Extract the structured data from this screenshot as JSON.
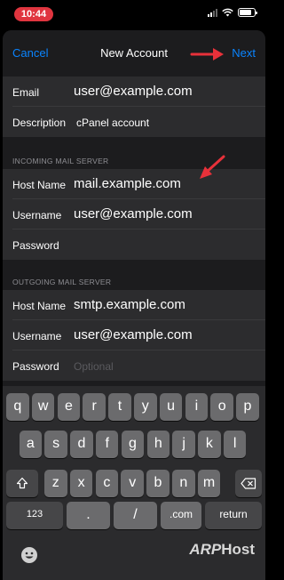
{
  "status_bar": {
    "time": "10:44"
  },
  "nav": {
    "cancel_label": "Cancel",
    "title": "New Account",
    "next_label": "Next"
  },
  "account": {
    "email_label": "Email",
    "email_value": "user@example.com",
    "description_label": "Description",
    "description_value": "cPanel account"
  },
  "incoming": {
    "header": "INCOMING MAIL SERVER",
    "host_label": "Host Name",
    "host_value": "mail.example.com",
    "username_label": "Username",
    "username_value": "user@example.com",
    "password_label": "Password"
  },
  "outgoing": {
    "header": "OUTGOING MAIL SERVER",
    "host_label": "Host Name",
    "host_value": "smtp.example.com",
    "username_label": "Username",
    "username_value": "user@example.com",
    "password_label": "Password",
    "password_placeholder": "Optional"
  },
  "keyboard": {
    "row1": [
      "q",
      "w",
      "e",
      "r",
      "t",
      "y",
      "u",
      "i",
      "o",
      "p"
    ],
    "row2": [
      "a",
      "s",
      "d",
      "f",
      "g",
      "h",
      "j",
      "k",
      "l"
    ],
    "row3": [
      "z",
      "x",
      "c",
      "v",
      "b",
      "n",
      "m"
    ],
    "numbers_label": "123",
    "dot_label": ".",
    "slash_label": "/",
    "dotcom_label": ".com",
    "return_label": "return"
  },
  "watermark": {
    "prefix": "ARP",
    "suffix": "Host"
  },
  "colors": {
    "accent": "#0a84ff",
    "annotation_arrow": "#e8313a",
    "time_pill": "#e0353f"
  }
}
